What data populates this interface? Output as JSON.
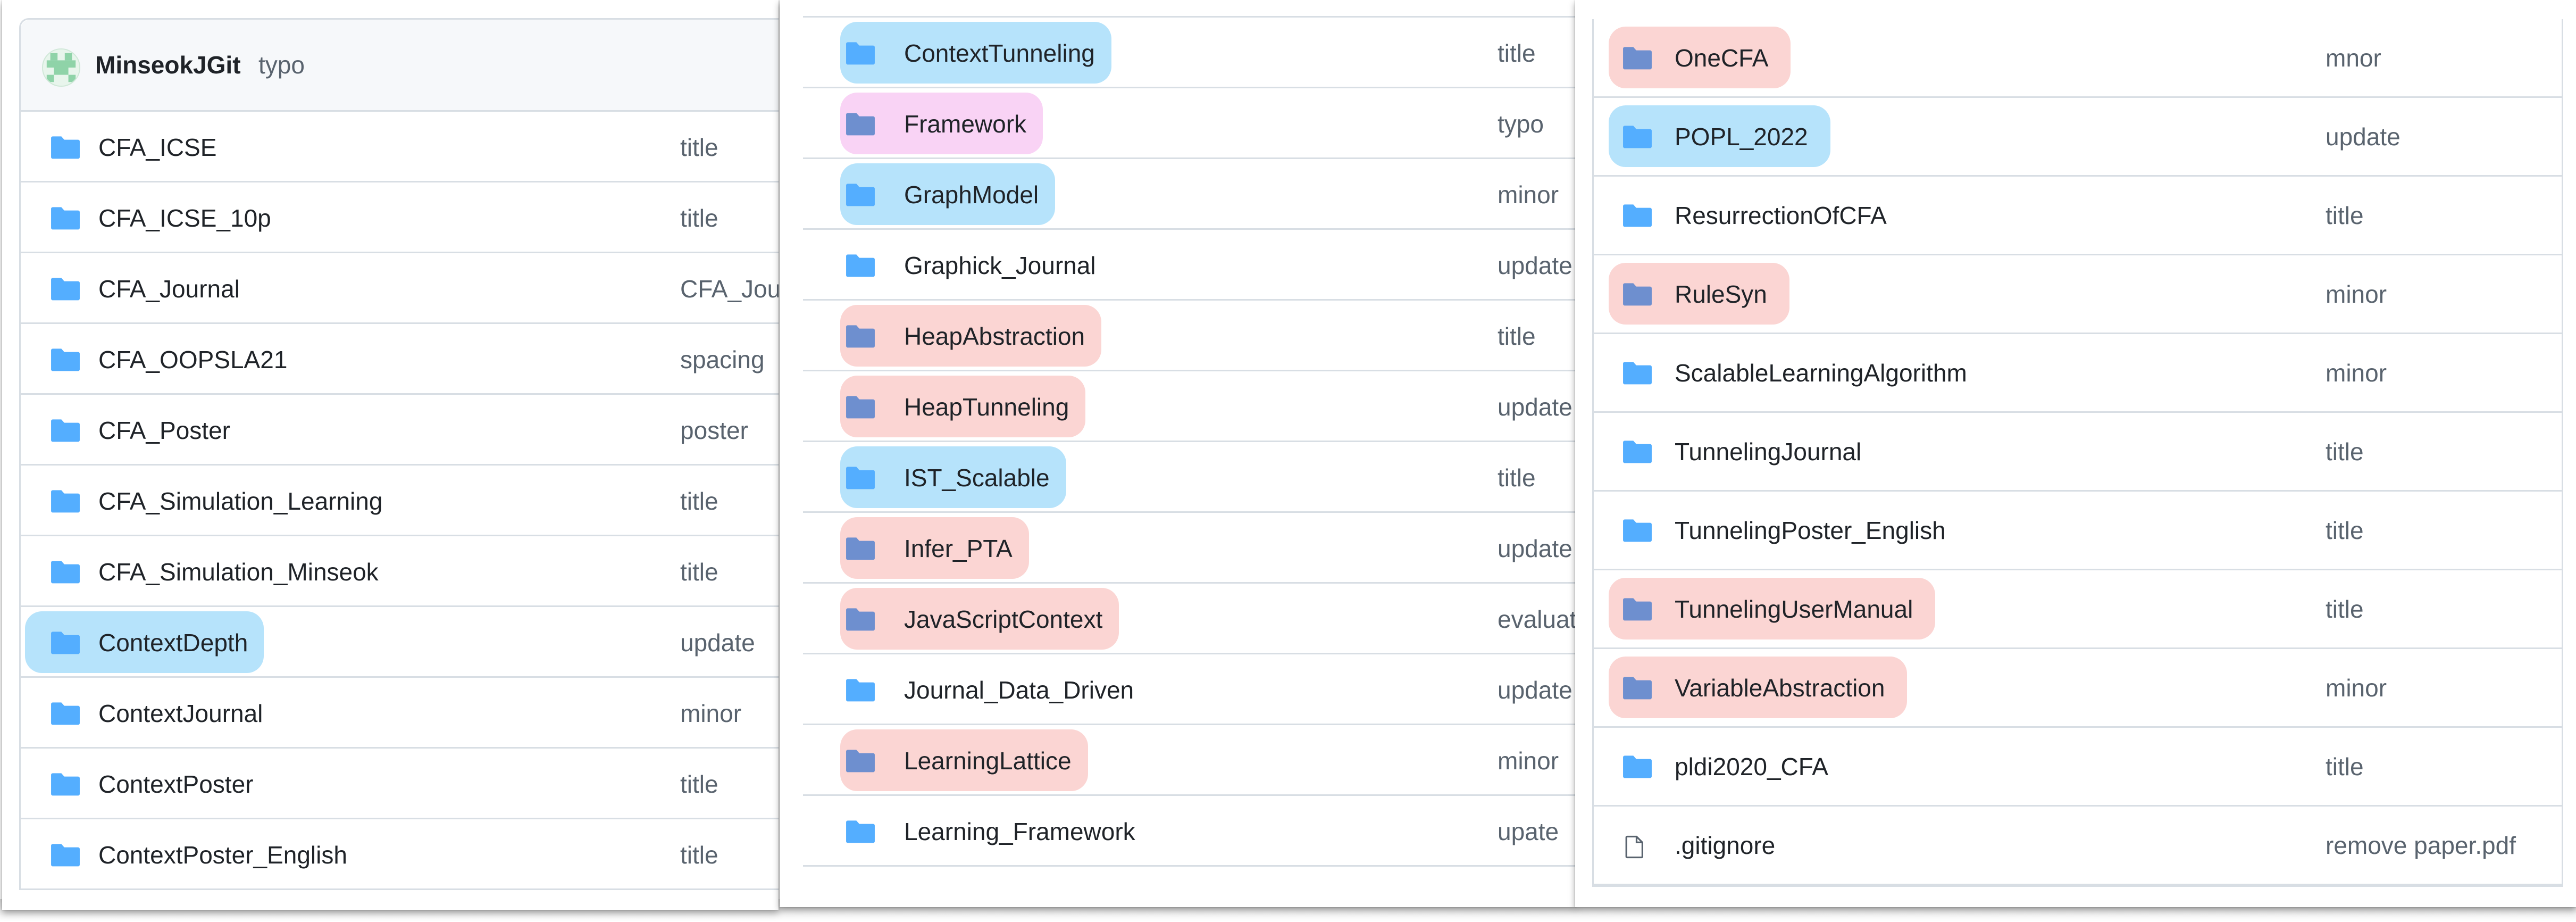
{
  "colors": {
    "folder": "#54aeff",
    "folder_dim": "#6e8fcf",
    "highlight_blue": "#b6e3fb",
    "highlight_pink": "#fbd5d3",
    "highlight_magenta": "#f9d3f5",
    "text": "#1f2328",
    "muted": "#59636e",
    "border": "#d8dee4"
  },
  "panel1": {
    "header": {
      "author": "MinseokJGit",
      "message": "typo"
    },
    "rows": [
      {
        "name": "CFA_ICSE",
        "commit": "title",
        "icon": "folder-icon",
        "hl": ""
      },
      {
        "name": "CFA_ICSE_10p",
        "commit": "title",
        "icon": "folder-icon",
        "hl": ""
      },
      {
        "name": "CFA_Journal",
        "commit": "CFA_Jou",
        "icon": "folder-icon",
        "hl": ""
      },
      {
        "name": "CFA_OOPSLA21",
        "commit": "spacing",
        "icon": "folder-icon",
        "hl": ""
      },
      {
        "name": "CFA_Poster",
        "commit": "poster",
        "icon": "folder-icon",
        "hl": ""
      },
      {
        "name": "CFA_Simulation_Learning",
        "commit": "title",
        "icon": "folder-icon",
        "hl": ""
      },
      {
        "name": "CFA_Simulation_Minseok",
        "commit": "title",
        "icon": "folder-icon",
        "hl": ""
      },
      {
        "name": "ContextDepth",
        "commit": "update",
        "icon": "folder-icon",
        "hl": "blue"
      },
      {
        "name": "ContextJournal",
        "commit": "minor",
        "icon": "folder-icon",
        "hl": ""
      },
      {
        "name": "ContextPoster",
        "commit": "title",
        "icon": "folder-icon",
        "hl": ""
      },
      {
        "name": "ContextPoster_English",
        "commit": "title",
        "icon": "folder-icon",
        "hl": ""
      }
    ]
  },
  "panel2": {
    "rows": [
      {
        "name": "ContextTunneling",
        "commit": "title",
        "icon": "folder-icon",
        "hl": "blue"
      },
      {
        "name": "Framework",
        "commit": "typo",
        "icon": "folder-icon",
        "hl": "magenta"
      },
      {
        "name": "GraphModel",
        "commit": "minor",
        "icon": "folder-icon",
        "hl": "blue"
      },
      {
        "name": "Graphick_Journal",
        "commit": "update",
        "icon": "folder-icon",
        "hl": ""
      },
      {
        "name": "HeapAbstraction",
        "commit": "title",
        "icon": "folder-icon",
        "hl": "pink"
      },
      {
        "name": "HeapTunneling",
        "commit": "update",
        "icon": "folder-icon",
        "hl": "pink"
      },
      {
        "name": "IST_Scalable",
        "commit": "title",
        "icon": "folder-icon",
        "hl": "blue"
      },
      {
        "name": "Infer_PTA",
        "commit": "update",
        "icon": "folder-icon",
        "hl": "pink"
      },
      {
        "name": "JavaScriptContext",
        "commit": "evaluatio",
        "icon": "folder-icon",
        "hl": "pink"
      },
      {
        "name": "Journal_Data_Driven",
        "commit": "update",
        "icon": "folder-icon",
        "hl": ""
      },
      {
        "name": "LearningLattice",
        "commit": "minor",
        "icon": "folder-icon",
        "hl": "pink"
      },
      {
        "name": "Learning_Framework",
        "commit": "upate",
        "icon": "folder-icon",
        "hl": ""
      }
    ]
  },
  "panel3": {
    "rows": [
      {
        "name": "OneCFA",
        "commit": "mnor",
        "icon": "folder-icon",
        "hl": "pink"
      },
      {
        "name": "POPL_2022",
        "commit": "update",
        "icon": "folder-icon",
        "hl": "blue"
      },
      {
        "name": "ResurrectionOfCFA",
        "commit": "title",
        "icon": "folder-icon",
        "hl": ""
      },
      {
        "name": "RuleSyn",
        "commit": "minor",
        "icon": "folder-icon",
        "hl": "pink"
      },
      {
        "name": "ScalableLearningAlgorithm",
        "commit": "minor",
        "icon": "folder-icon",
        "hl": ""
      },
      {
        "name": "TunnelingJournal",
        "commit": "title",
        "icon": "folder-icon",
        "hl": ""
      },
      {
        "name": "TunnelingPoster_English",
        "commit": "title",
        "icon": "folder-icon",
        "hl": ""
      },
      {
        "name": "TunnelingUserManual",
        "commit": "title",
        "icon": "folder-icon",
        "hl": "pink"
      },
      {
        "name": "VariableAbstraction",
        "commit": "minor",
        "icon": "folder-icon",
        "hl": "pink"
      },
      {
        "name": "pldi2020_CFA",
        "commit": "title",
        "icon": "folder-icon",
        "hl": ""
      },
      {
        "name": ".gitignore",
        "commit": "remove paper.pdf",
        "icon": "file-icon",
        "hl": ""
      }
    ]
  }
}
